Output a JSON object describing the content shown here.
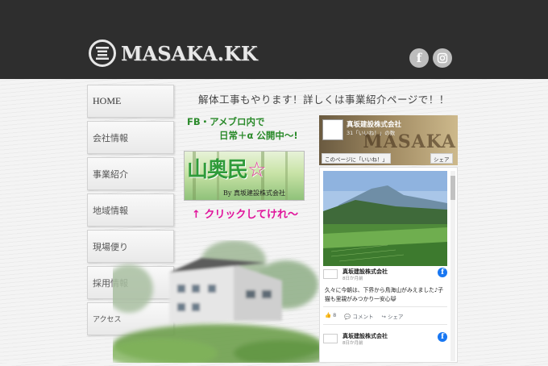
{
  "header": {
    "logo_text": "MASAKA.KK",
    "social": {
      "facebook_icon": "facebook-icon",
      "instagram_icon": "instagram-icon"
    }
  },
  "nav": {
    "items": [
      {
        "label": "HOME"
      },
      {
        "label": "会社情報"
      },
      {
        "label": "事業紹介"
      },
      {
        "label": "地域情報"
      },
      {
        "label": "現場便り"
      },
      {
        "label": "採用情報"
      },
      {
        "label": "アクセス"
      }
    ]
  },
  "main": {
    "banner_text": "解体工事もやります！詳しくは事業紹介ページで！！",
    "fb_note_line1": "FB・アメブロ内で",
    "fb_note_line2": "日常＋α 公開中〜!",
    "yama_banner": {
      "title": "山奥民",
      "star": "☆",
      "by": "By 真坂建設株式会社"
    },
    "click_note": "↑ クリックしてけれ〜"
  },
  "fb_widget": {
    "page_name": "真坂建設株式会社",
    "likes": "31「いいね！」の数",
    "cover_text": "MASAKA",
    "like_button": "このページに「いいね！」",
    "share_button": "シェア",
    "posts": [
      {
        "author": "真坂建設株式会社",
        "time": "8日か月前",
        "body": "久々に今朝は、下界から鳥海山がみえました♪子猫も里親がみつかり一安心😺",
        "likes": "8",
        "comment": "コメント",
        "share": "シェア"
      },
      {
        "author": "真坂建設株式会社",
        "time": "8日か月前"
      }
    ]
  },
  "colors": {
    "header_bg": "#2e2e2e",
    "green": "#2a8a2a",
    "pink": "#e0149b",
    "fb_blue": "#1877f2"
  }
}
